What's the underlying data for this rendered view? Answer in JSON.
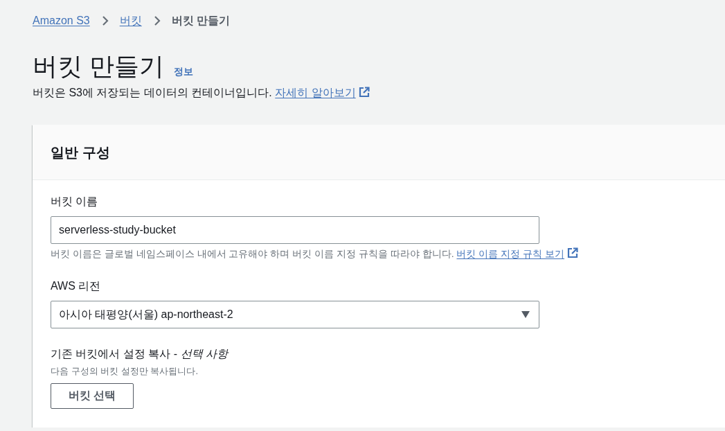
{
  "breadcrumbs": [
    {
      "label": "Amazon S3",
      "current": false
    },
    {
      "label": "버킷",
      "current": false
    },
    {
      "label": "버킷 만들기",
      "current": true
    }
  ],
  "header": {
    "title": "버킷 만들기",
    "info_link": "정보",
    "description": "버킷은 S3에 저장되는 데이터의 컨테이너입니다.",
    "learn_more_link": "자세히 알아보기"
  },
  "panel": {
    "title": "일반 구성",
    "fields": [
      {
        "kind": "text",
        "label": "버킷 이름",
        "value": "serverless-study-bucket",
        "hint": "버킷 이름은 글로벌 네임스페이스 내에서 고유해야 하며 버킷 이름 지정 규칙을 따라야 합니다.",
        "hint_link": "버킷 이름 지정 규칙 보기"
      },
      {
        "kind": "select",
        "label": "AWS 리전",
        "value": "아시아 태평양(서울) ap-northeast-2"
      },
      {
        "kind": "button",
        "label": "기존 버킷에서 설정 복사 - *선택 사항*",
        "hint": "다음 구성의 버킷 설정만 복사됩니다.",
        "button": "버킷 선택"
      }
    ]
  }
}
